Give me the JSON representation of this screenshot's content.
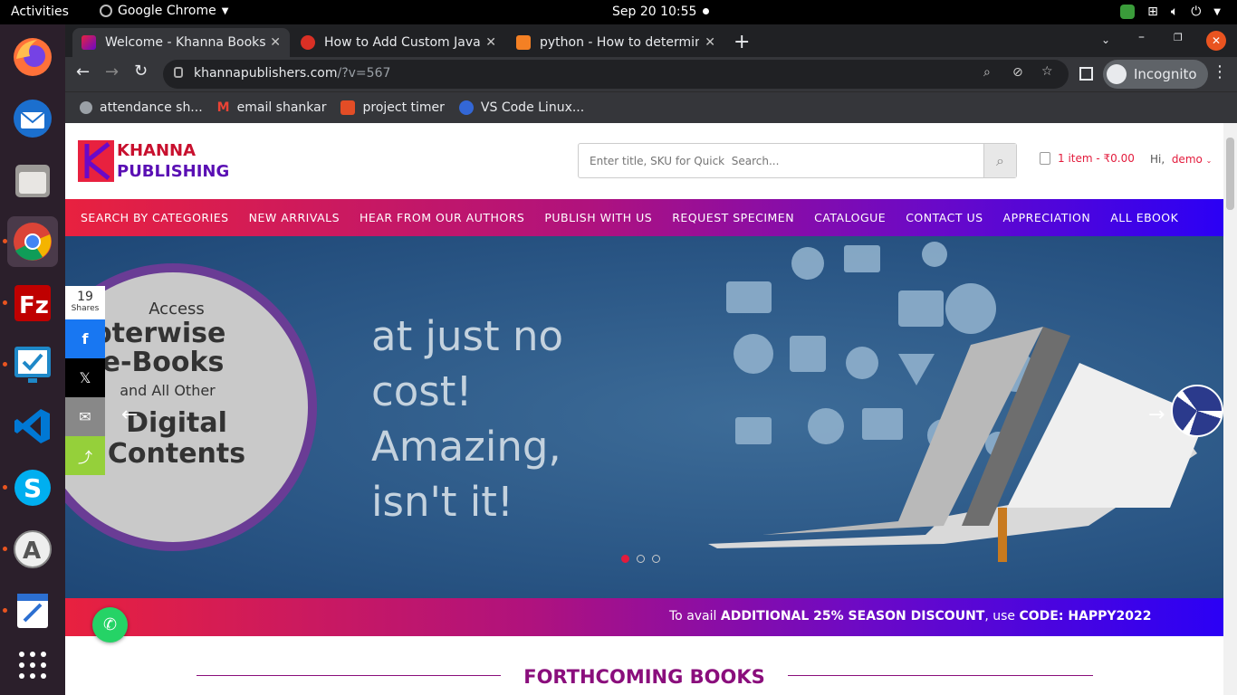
{
  "topbar": {
    "activities": "Activities",
    "app_name": "Google Chrome",
    "clock": "Sep 20  10:55"
  },
  "dock": {
    "apps": [
      "firefox-icon",
      "thunderbird-icon",
      "files-icon",
      "chrome-icon",
      "filezilla-icon",
      "monitor-icon",
      "vscode-icon",
      "skype-icon",
      "software-icon",
      "text-editor-icon",
      "app-grid-icon"
    ]
  },
  "tabs": [
    {
      "title": "Welcome - Khanna Books",
      "active": true
    },
    {
      "title": "How to Add Custom Java",
      "active": false
    },
    {
      "title": "python - How to determin",
      "active": false
    }
  ],
  "address_bar": {
    "url_host": "khannapublishers.com",
    "url_rest": "/?v=567",
    "profile": "Incognito"
  },
  "bookmarks": [
    {
      "label": "attendance sh..."
    },
    {
      "label": "email shankar"
    },
    {
      "label": "project timer"
    },
    {
      "label": "VS Code Linux..."
    }
  ],
  "site": {
    "logo_line1": "KHANNA",
    "logo_line2": "PUBLISHING",
    "search_placeholder": "Enter title, SKU for Quick  Search...",
    "cart_text": "1 item - ₹0.00",
    "greeting": "Hi,",
    "username": "demo",
    "nav": [
      "SEARCH BY CATEGORIES",
      "NEW ARRIVALS",
      "HEAR FROM OUR AUTHORS",
      "PUBLISH WITH US",
      "REQUEST SPECIMEN",
      "CATALOGUE",
      "CONTACT US",
      "APPRECIATION",
      "ALL EBOOK"
    ],
    "hero": {
      "circle_line1": "Access",
      "circle_line2": "hapterwise",
      "circle_line3": "e-Books",
      "circle_line4": "and All Other",
      "circle_line5": "Digital",
      "circle_line6": "Contents",
      "tagline_line1": "at just no",
      "tagline_line2": "cost!",
      "tagline_line3": "Amazing,",
      "tagline_line4": "isn't it!",
      "slide_count": 3,
      "active_slide": 1
    },
    "share": {
      "count": "19",
      "label": "Shares"
    },
    "promo": {
      "prefix": "To avail ",
      "bold1": "ADDITIONAL 25% SEASON DISCOUNT",
      "middle": ", use ",
      "bold2": "CODE: HAPPY2022"
    },
    "section_title": "FORTHCOMING BOOKS"
  }
}
